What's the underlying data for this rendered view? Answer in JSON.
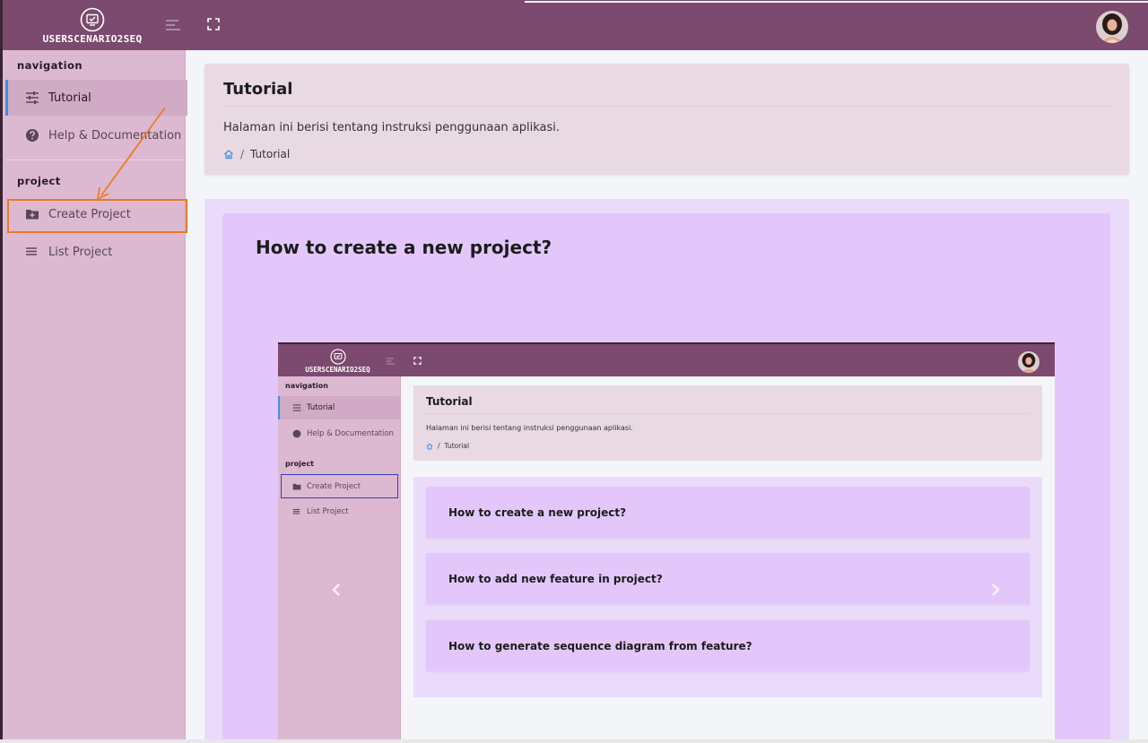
{
  "app": {
    "brand_name": "USERSCENARIO2SEQ"
  },
  "icons": {
    "logo": "monitor-check-icon",
    "toggle": "menu-toggle-icon",
    "fullscreen": "fullscreen-icon",
    "avatar": "user-avatar"
  },
  "colors": {
    "topbar": "#7b4a6e",
    "sidebar": "#dcb9d1",
    "active_indicator": "#3b8fe3",
    "highlight_box": "#ef7b22",
    "inner_highlight_box": "#3b3fc2",
    "slide_bg": "#e3c7fb"
  },
  "sidebar": {
    "sections": [
      {
        "label": "navigation",
        "items": [
          {
            "label": "Tutorial",
            "icon": "sliders-icon",
            "active": true
          },
          {
            "label": "Help & Documentation",
            "icon": "question-circle-icon",
            "active": false
          }
        ]
      },
      {
        "label": "project",
        "items": [
          {
            "label": "Create Project",
            "icon": "folder-plus-icon",
            "active": false,
            "highlighted": true
          },
          {
            "label": "List Project",
            "icon": "list-icon",
            "active": false
          }
        ]
      }
    ]
  },
  "header": {
    "title": "Tutorial",
    "description": "Halaman ini berisi tentang instruksi penggunaan aplikasi.",
    "breadcrumb": {
      "home_icon": "home-icon",
      "separator": "/",
      "current": "Tutorial"
    }
  },
  "carousel": {
    "slide_title": "How to create a new project?",
    "prev_icon": "chevron-left-icon",
    "next_icon": "chevron-right-icon",
    "embedded_screenshot": {
      "brand_name": "USERSCENARIO2SEQ",
      "sidebar": {
        "section_navigation": "navigation",
        "item_tutorial": "Tutorial",
        "item_help": "Help & Documentation",
        "section_project": "project",
        "item_create": "Create Project",
        "item_list": "List Project"
      },
      "header": {
        "title": "Tutorial",
        "description": "Halaman ini berisi tentang instruksi penggunaan aplikasi.",
        "separator": "/",
        "breadcrumb_current": "Tutorial"
      },
      "accordion": [
        "How to create a new project?",
        "How to add new feature in project?",
        "How to generate sequence diagram from feature?"
      ]
    }
  }
}
